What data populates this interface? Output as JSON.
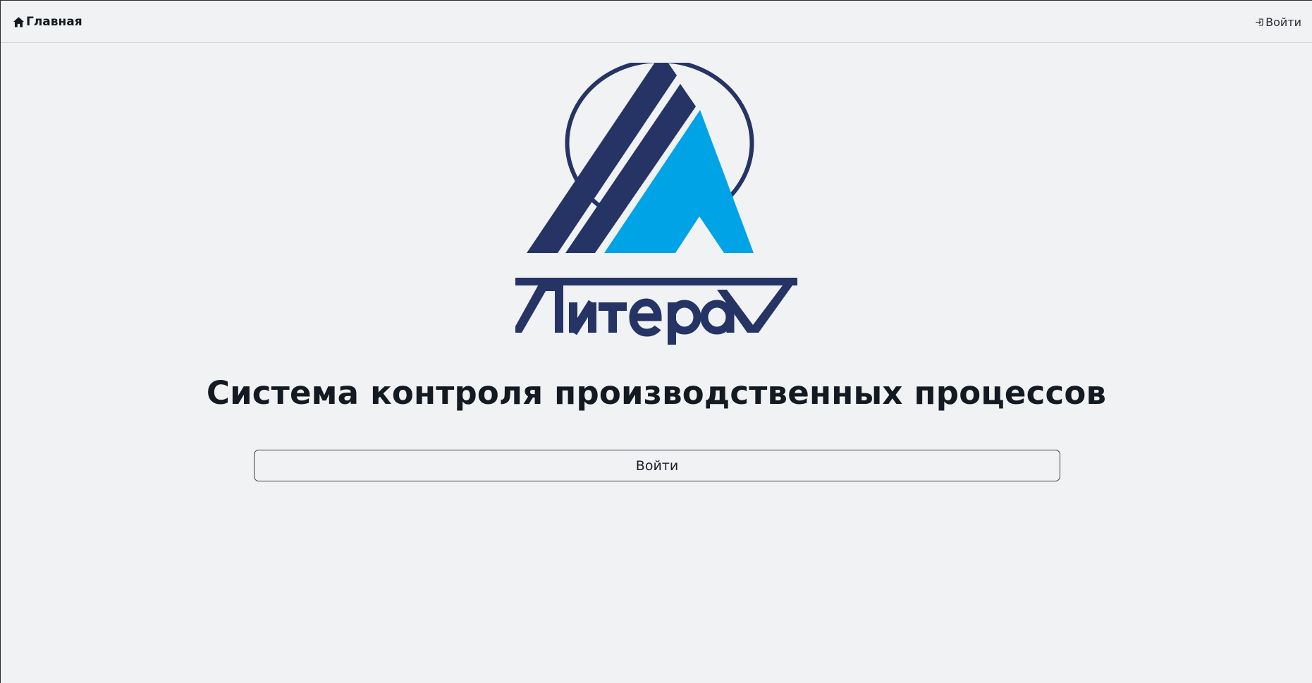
{
  "nav": {
    "home_label": "Главная",
    "login_label": "Войти"
  },
  "logo": {
    "wordmark": "ЛитераV",
    "colors": {
      "dark": "#253464",
      "light": "#00a3e6"
    }
  },
  "main": {
    "title": "Система контроля производственных процессов",
    "login_button_label": "Войти"
  },
  "icons": {
    "home": "home-icon",
    "login": "sign-in-icon"
  }
}
